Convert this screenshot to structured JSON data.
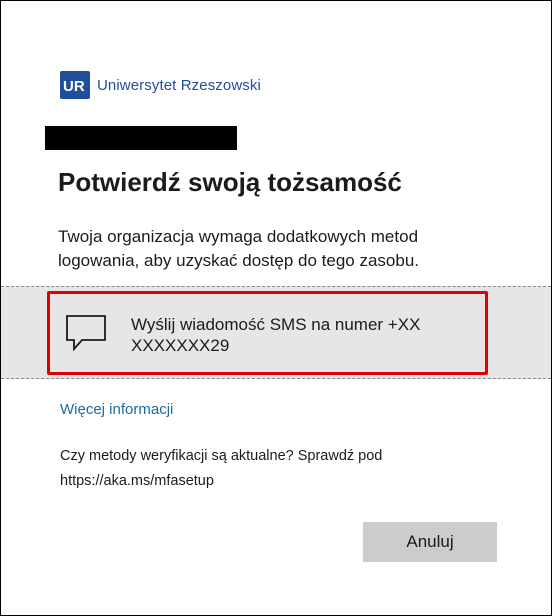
{
  "organization": {
    "logo_icon": "ur-logo-icon",
    "logo_text": "UR",
    "name": "Uniwersytet Rzeszowski",
    "brand_color": "#1f4e9a"
  },
  "account": {
    "email_redacted": ""
  },
  "dialog": {
    "title": "Potwierdź swoją tożsamość",
    "description": "Twoja organizacja wymaga dodatkowych metod logowania, aby uzyskać dostęp do tego zasobu."
  },
  "methods": [
    {
      "icon": "sms-speech-bubble-icon",
      "label": "Wyślij wiadomość SMS na numer +XX XXXXXXX29",
      "highlight_color": "#e00000"
    }
  ],
  "links": {
    "more_info": "Więcej informacji",
    "link_color": "#1a6aa8"
  },
  "hint": {
    "text": "Czy metody weryfikacji są aktualne? Sprawdź pod https://aka.ms/mfasetup"
  },
  "buttons": {
    "cancel": "Anuluj"
  }
}
